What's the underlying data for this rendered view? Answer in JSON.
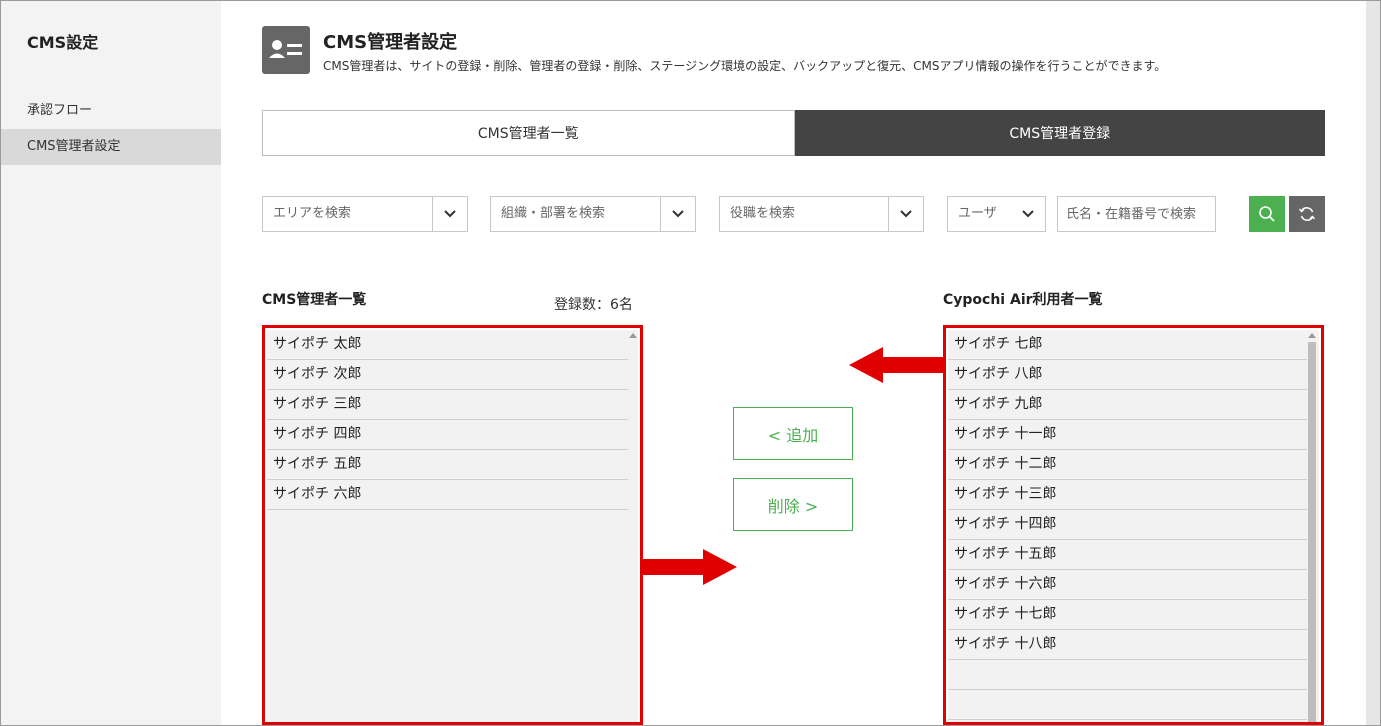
{
  "sidebar": {
    "title": "CMS設定",
    "items": [
      {
        "label": "承認フロー"
      },
      {
        "label": "CMS管理者設定"
      }
    ]
  },
  "header": {
    "title": "CMS管理者設定",
    "description": "CMS管理者は、サイトの登録・削除、管理者の登録・削除、ステージング環境の設定、バックアップと復元、CMSアプリ情報の操作を行うことができます。"
  },
  "tabs": [
    {
      "label": "CMS管理者一覧"
    },
    {
      "label": "CMS管理者登録"
    }
  ],
  "filters": {
    "area": "エリアを検索",
    "dept": "組織・部署を検索",
    "role": "役職を検索",
    "type": "ユーザ",
    "name_placeholder": "氏名・在籍番号で検索"
  },
  "left_list": {
    "title": "CMS管理者一覧",
    "count": "登録数：6名",
    "items": [
      "サイポチ 太郎",
      "サイポチ 次郎",
      "サイポチ 三郎",
      "サイポチ 四郎",
      "サイポチ 五郎",
      "サイポチ 六郎"
    ]
  },
  "right_list": {
    "title": "Cypochi Air利用者一覧",
    "items": [
      "サイポチ 七郎",
      "サイポチ 八郎",
      "サイポチ 九郎",
      "サイポチ 十一郎",
      "サイポチ 十二郎",
      "サイポチ 十三郎",
      "サイポチ 十四郎",
      "サイポチ 十五郎",
      "サイポチ 十六郎",
      "サイポチ 十七郎",
      "サイポチ 十八郎"
    ]
  },
  "actions": {
    "add": "< 追加",
    "remove": "削除 >"
  },
  "colors": {
    "accent_green": "#4caf50",
    "highlight_red": "#e00000",
    "active_tab": "#444444"
  }
}
